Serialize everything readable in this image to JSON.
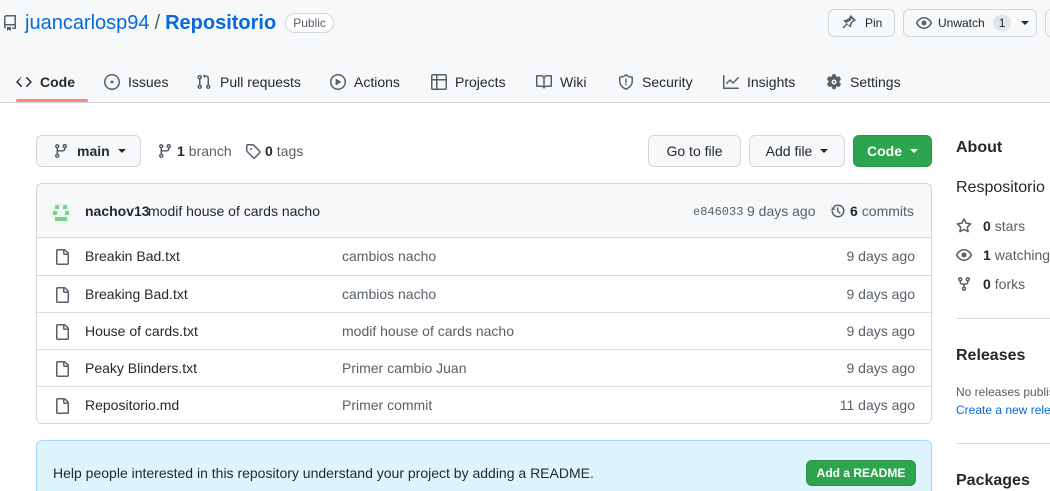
{
  "repo": {
    "owner": "juancarlosp94",
    "separator": "/",
    "name": "Repositorio",
    "visibility": "Public"
  },
  "header_actions": {
    "pin_label": "Pin",
    "watch_label": "Unwatch",
    "watch_count": "1"
  },
  "tabs": [
    {
      "label": "Code",
      "icon": "code-icon",
      "active": true
    },
    {
      "label": "Issues",
      "icon": "issue-icon"
    },
    {
      "label": "Pull requests",
      "icon": "pull-request-icon"
    },
    {
      "label": "Actions",
      "icon": "play-icon"
    },
    {
      "label": "Projects",
      "icon": "table-icon"
    },
    {
      "label": "Wiki",
      "icon": "book-icon"
    },
    {
      "label": "Security",
      "icon": "shield-icon"
    },
    {
      "label": "Insights",
      "icon": "graph-icon"
    },
    {
      "label": "Settings",
      "icon": "gear-icon"
    }
  ],
  "branch_bar": {
    "branch": "main",
    "branches_count": "1",
    "branches_label": "branch",
    "tags_count": "0",
    "tags_label": "tags",
    "goto_label": "Go to file",
    "addfile_label": "Add file",
    "code_label": "Code"
  },
  "latest_commit": {
    "author": "nachov13",
    "message": "modif house of cards nacho",
    "sha": "e846033",
    "time": "9 days ago",
    "commits_count": "6",
    "commits_label": "commits"
  },
  "files": [
    {
      "name": "Breakin Bad.txt",
      "message": "cambios nacho",
      "age": "9 days ago"
    },
    {
      "name": "Breaking Bad.txt",
      "message": "cambios nacho",
      "age": "9 days ago"
    },
    {
      "name": "House of cards.txt",
      "message": "modif house of cards nacho",
      "age": "9 days ago"
    },
    {
      "name": "Peaky Blinders.txt",
      "message": "Primer cambio Juan",
      "age": "9 days ago"
    },
    {
      "name": "Repositorio.md",
      "message": "Primer commit",
      "age": "11 days ago"
    }
  ],
  "readme_banner": {
    "text": "Help people interested in this repository understand your project by adding a README.",
    "button": "Add a README"
  },
  "sidebar": {
    "about_title": "About",
    "description": "Respositorio G",
    "stars_count": "0",
    "stars_label": "stars",
    "watching_count": "1",
    "watching_label": "watching",
    "forks_count": "0",
    "forks_label": "forks",
    "releases_title": "Releases",
    "releases_text": "No releases publis",
    "releases_link": "Create a new relea",
    "packages_title": "Packages"
  },
  "colors": {
    "accent_link": "#0969da",
    "primary_green": "#2da44e",
    "tab_underline": "#fd8c73",
    "banner_bg": "#ddf4ff"
  }
}
